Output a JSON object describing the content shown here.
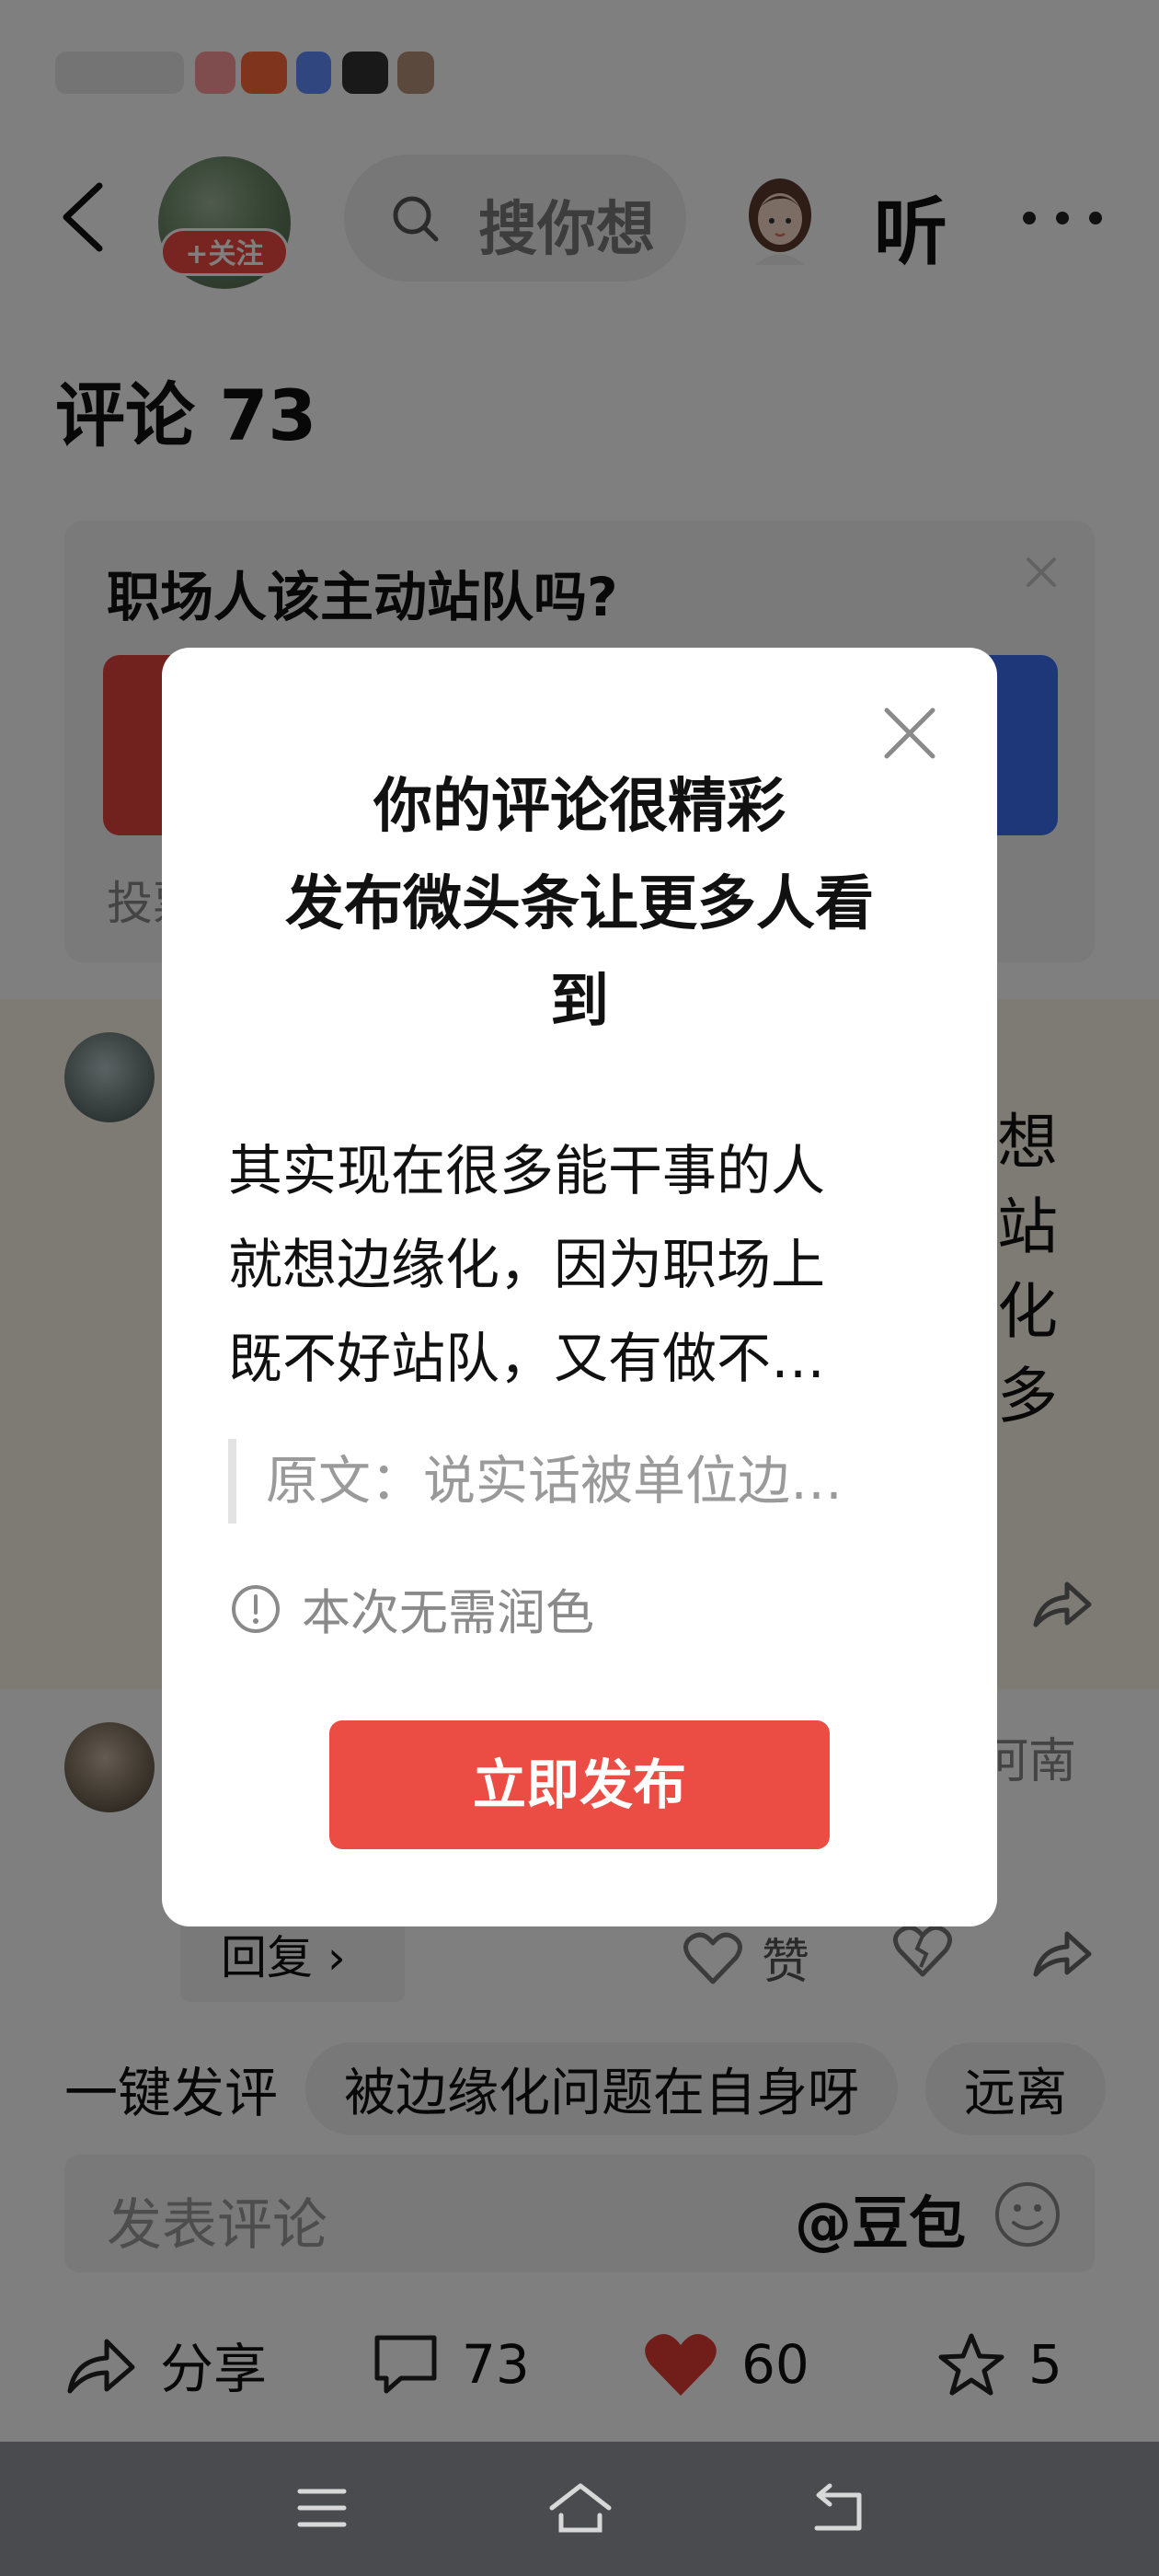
{
  "header": {
    "follow_label": "+关注",
    "search_placeholder": "搜你想",
    "listen_label": "听"
  },
  "comments_header": {
    "title": "评论 73"
  },
  "poll": {
    "question": "职场人该主动站队吗?",
    "footer_text": "投票"
  },
  "comment1": {
    "visible_text": [
      "想",
      "站",
      "化",
      "多"
    ]
  },
  "comment2": {
    "location": "河南",
    "reply_label": "回复 ›",
    "like_label": "赞"
  },
  "quick_comments": {
    "first": "一键发评",
    "chips": [
      "被边缘化问题在自身呀",
      "远离"
    ]
  },
  "comment_input": {
    "placeholder": "发表评论",
    "doubao": "@豆包"
  },
  "actions": {
    "share_label": "分享",
    "comment_count": "73",
    "like_count": "60",
    "favorite_count": "5"
  },
  "dialog": {
    "title_lines": [
      "你的评论很精彩",
      "发布微头条让更多人看",
      "到"
    ],
    "body_lines": [
      "其实现在很多能干事的人",
      "就想边缘化，因为职场上",
      "既不好站队，又有做不…"
    ],
    "quote": "原文：说实话被单位边…",
    "note": "本次无需润色",
    "publish_button": "立即发布"
  },
  "colors": {
    "accent_red": "#eb4d44",
    "poll_red": "#e5443c",
    "poll_blue": "#3d6ff0",
    "like_heart": "#e33a35"
  }
}
